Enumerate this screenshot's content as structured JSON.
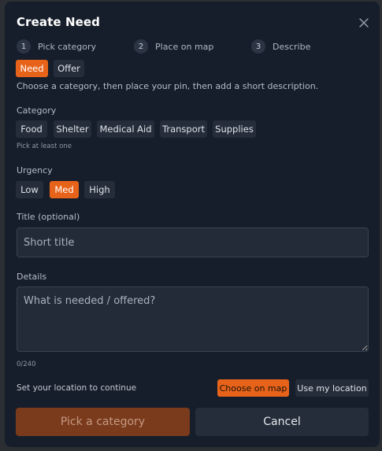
{
  "modal": {
    "title": "Create Need",
    "close_icon": "close-icon"
  },
  "steps": [
    {
      "num": "1",
      "label": "Pick category"
    },
    {
      "num": "2",
      "label": "Place on map"
    },
    {
      "num": "3",
      "label": "Describe"
    }
  ],
  "type_toggle": {
    "need": "Need",
    "offer": "Offer",
    "selected": "Need"
  },
  "helper_text": "Choose a category, then place your pin, then add a short description.",
  "category": {
    "label": "Category",
    "options": [
      "Food",
      "Shelter",
      "Medical Aid",
      "Transport",
      "Supplies"
    ],
    "hint": "Pick at least one"
  },
  "urgency": {
    "label": "Urgency",
    "options": [
      "Low",
      "Med",
      "High"
    ],
    "selected": "Med"
  },
  "title_field": {
    "label": "Title (optional)",
    "placeholder": "Short title",
    "value": ""
  },
  "details_field": {
    "label": "Details",
    "placeholder": "What is needed / offered?",
    "value": "",
    "counter": "0/240"
  },
  "location": {
    "prompt": "Set your location to continue",
    "choose_on_map": "Choose on map",
    "use_my_location": "Use my location"
  },
  "actions": {
    "submit": "Pick a category",
    "cancel": "Cancel"
  },
  "colors": {
    "accent": "#e8631a",
    "submit_disabled": "#7a3a1c",
    "panel": "#161e2b"
  }
}
